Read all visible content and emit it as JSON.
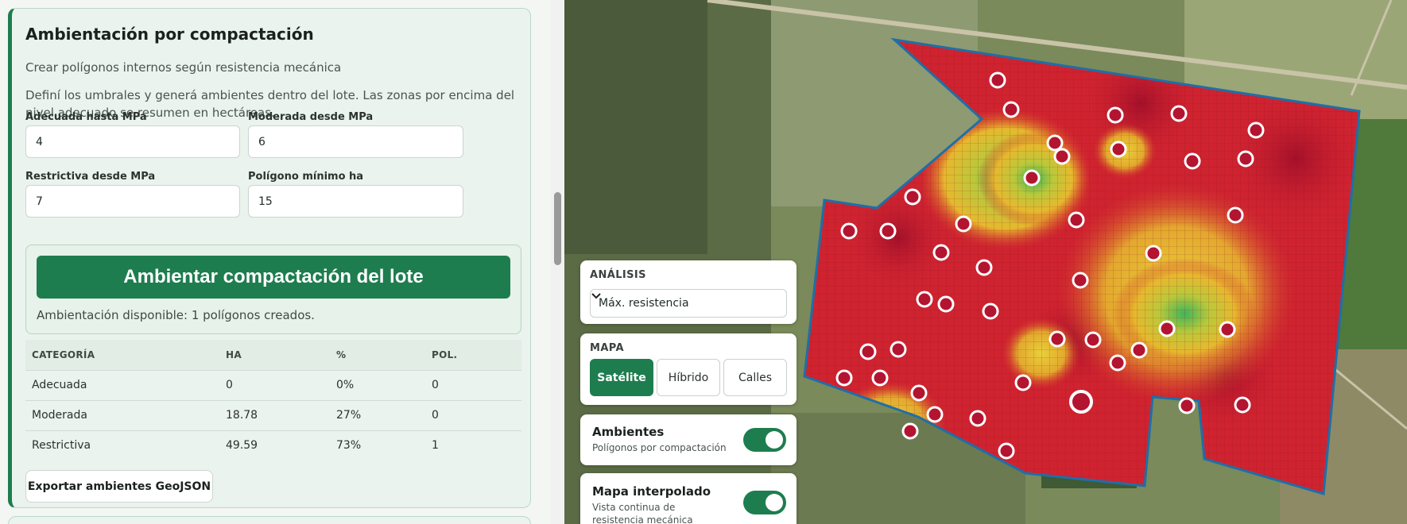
{
  "panel": {
    "title": "Ambientación por compactación",
    "subtitle": "Crear polígonos internos según resistencia mecánica",
    "description": "Definí los umbrales y generá ambientes dentro del lote. Las zonas por encima del nivel adecuado se resumen en hectáreas.",
    "fields": {
      "adequate_label": "Adecuada hasta MPa",
      "adequate_value": "4",
      "moderate_label": "Moderada desde MPa",
      "moderate_value": "6",
      "restrictive_label": "Restrictiva desde MPa",
      "restrictive_value": "7",
      "min_polygon_label": "Polígono mínimo ha",
      "min_polygon_value": "15"
    },
    "action_label": "Ambientar compactación del lote",
    "action_status": "Ambientación disponible: 1 polígonos creados.",
    "table": {
      "headers": [
        "CATEGORÍA",
        "HA",
        "%",
        "POL."
      ],
      "rows": [
        [
          "Adecuada",
          "0",
          "0%",
          "0"
        ],
        [
          "Moderada",
          "18.78",
          "27%",
          "0"
        ],
        [
          "Restrictiva",
          "49.59",
          "73%",
          "1"
        ]
      ]
    },
    "export_label": "Exportar ambientes GeoJSON"
  },
  "map_controls": {
    "analysis_label": "ANÁLISIS",
    "analysis_selected": "Máx. resistencia",
    "map_label": "MAPA",
    "map_types": [
      "Satélite",
      "Híbrido",
      "Calles"
    ],
    "map_type_active": "Satélite",
    "ambientes_title": "Ambientes",
    "ambientes_sub": "Polígonos por compactación",
    "ambientes_on": true,
    "interp_title": "Mapa interpolado",
    "interp_sub": "Vista continua de resistencia mecánica",
    "interp_on": true
  },
  "colors": {
    "brand_green": "#1e7d4f",
    "restrictive": "#c0202f",
    "moderate": "#e0c53a",
    "adequate": "#34a853",
    "field_border": "#1e6fa8"
  },
  "icons": {
    "select_chevron": "chevron-down-icon",
    "sample_point": "sample-point-icon"
  }
}
